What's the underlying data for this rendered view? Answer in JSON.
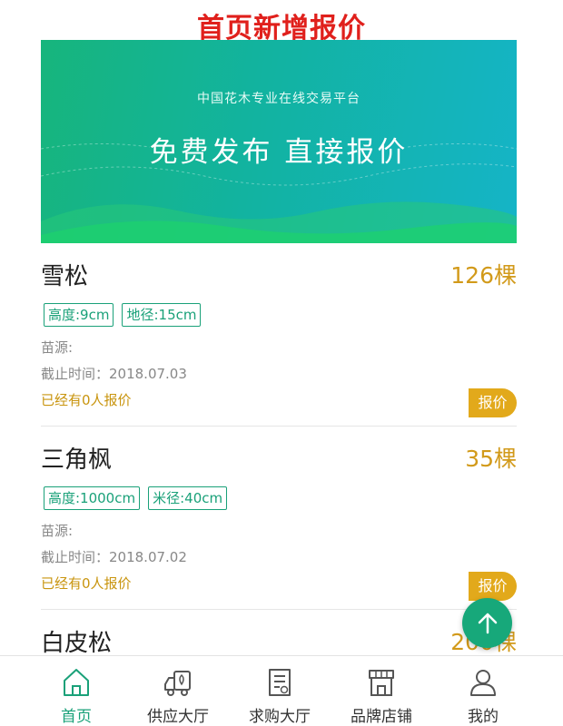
{
  "heading": "首页新增报价",
  "banner": {
    "subtitle": "中国花木专业在线交易平台",
    "slogan": "免费发布 直接报价"
  },
  "listings": [
    {
      "name": "雪松",
      "quantity": "126棵",
      "tags": [
        "高度:9cm",
        "地径:15cm"
      ],
      "source": "苗源:",
      "deadline": "截止时间：2018.07.03",
      "offers": "已经有0人报价",
      "quote_label": "报价"
    },
    {
      "name": "三角枫",
      "quantity": "35棵",
      "tags": [
        "高度:1000cm",
        "米径:40cm"
      ],
      "source": "苗源:",
      "deadline": "截止时间：2018.07.02",
      "offers": "已经有0人报价",
      "quote_label": "报价"
    },
    {
      "name": "白皮松",
      "quantity": "200棵"
    }
  ],
  "tabs": [
    {
      "label": "首页",
      "icon": "home-icon",
      "active": true
    },
    {
      "label": "供应大厅",
      "icon": "truck-icon",
      "active": false
    },
    {
      "label": "求购大厅",
      "icon": "document-icon",
      "active": false
    },
    {
      "label": "品牌店铺",
      "icon": "store-icon",
      "active": false
    },
    {
      "label": "我的",
      "icon": "user-icon",
      "active": false
    }
  ],
  "colors": {
    "heading": "#e0201c",
    "accent": "#1aa179",
    "quantity": "#d29a1a",
    "quote_button": "#e2a91b",
    "banner_start": "#17b57c",
    "banner_end": "#15b4c7"
  }
}
